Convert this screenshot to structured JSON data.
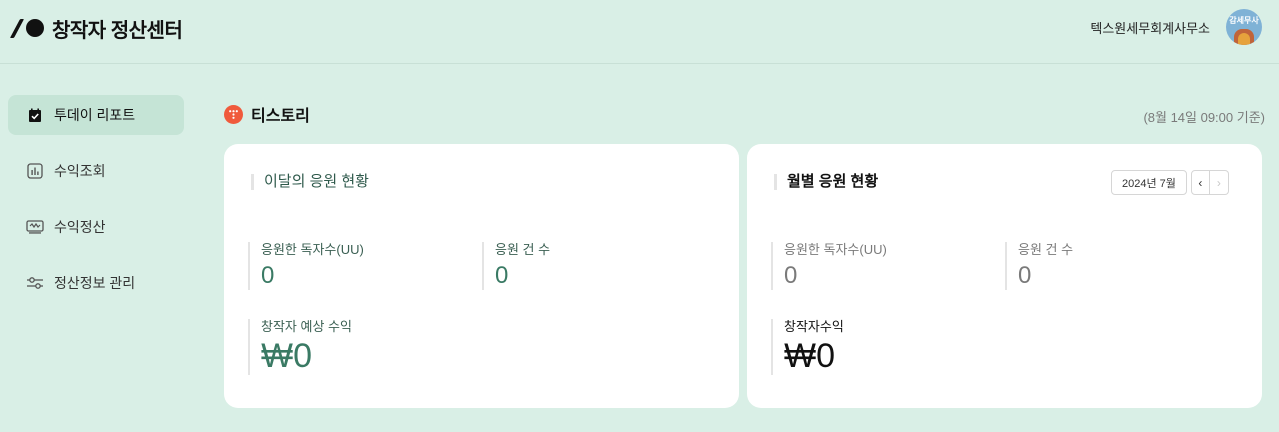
{
  "header": {
    "app_title": "창작자 정산센터",
    "account_name": "텍스원세무회계사무소",
    "avatar_text": "감세무사"
  },
  "sidebar": {
    "items": [
      {
        "label": "투데이 리포트",
        "icon": "calendar-check-icon",
        "active": true
      },
      {
        "label": "수익조회",
        "icon": "bar-chart-icon",
        "active": false
      },
      {
        "label": "수익정산",
        "icon": "wallet-icon",
        "active": false
      },
      {
        "label": "정산정보 관리",
        "icon": "sliders-icon",
        "active": false
      }
    ]
  },
  "main": {
    "blog_name": "티스토리",
    "timestamp": "(8월 14일 09:00 기준)",
    "this_month": {
      "title": "이달의 응원 현황",
      "readers_label": "응원한 독자수(UU)",
      "readers_value": "0",
      "count_label": "응원 건 수",
      "count_value": "0",
      "revenue_label": "창작자 예상 수익",
      "revenue_value": "₩0"
    },
    "monthly": {
      "title": "월별 응원 현황",
      "month_label": "2024년 7월",
      "prev_label": "‹",
      "next_label": "›",
      "readers_label": "응원한 독자수(UU)",
      "readers_value": "0",
      "count_label": "응원 건 수",
      "count_value": "0",
      "revenue_label": "창작자수익",
      "revenue_value": "₩0"
    }
  },
  "colors": {
    "background": "#d9efe6",
    "accent": "#3a7a64",
    "tistory": "#f05a3c"
  }
}
